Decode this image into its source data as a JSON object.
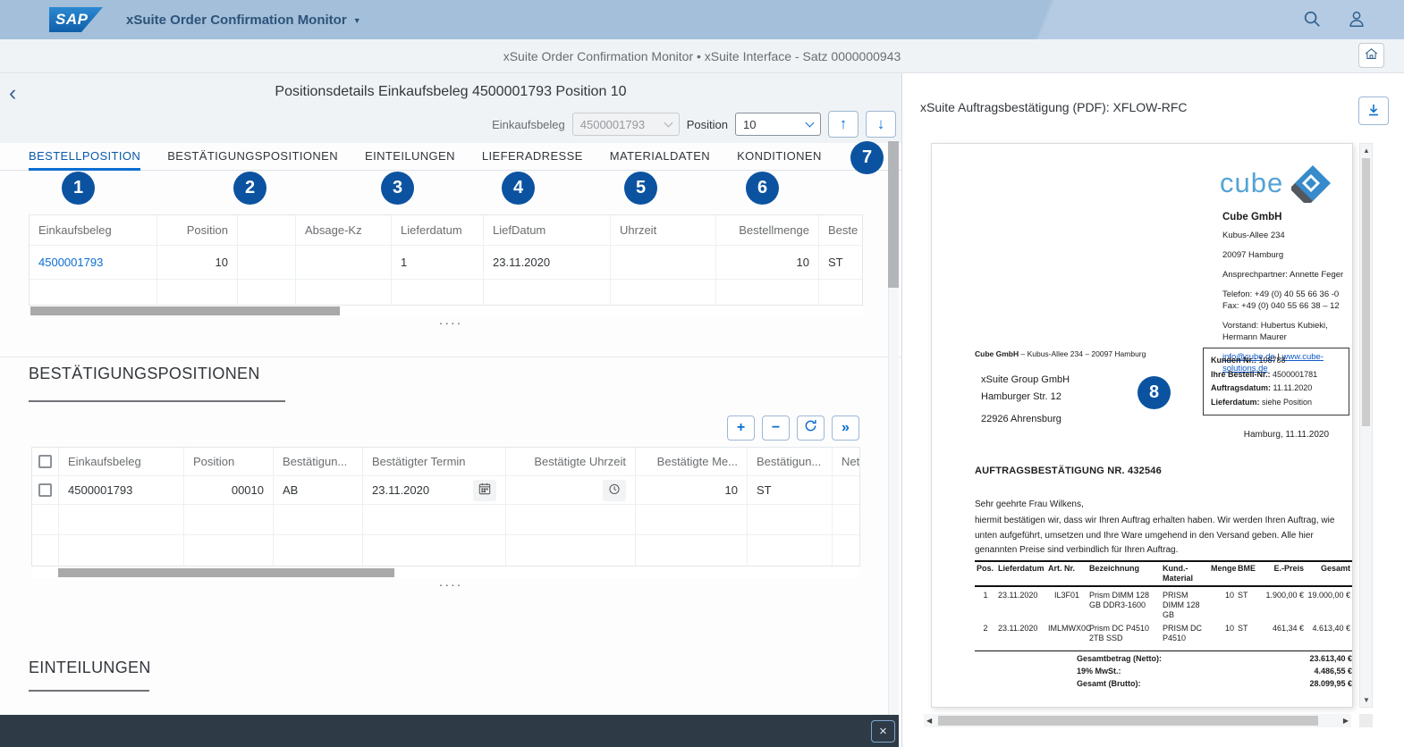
{
  "palette": {
    "accent": "#0a6ed1",
    "shell": "#a3bfda",
    "badge": "#0b53a0",
    "footer_bar": "#2e3b47",
    "link": "#0a6ed1"
  },
  "icons": {
    "back": "‹",
    "menu_caret": "▼",
    "nav_up": "↑",
    "nav_down": "↓",
    "add": "+",
    "remove": "−",
    "forward": "»",
    "close": "×",
    "scroll_up": "▲",
    "scroll_down": "▼",
    "scroll_left": "◀",
    "scroll_right": "▶"
  },
  "shell": {
    "logo_text": "SAP",
    "app_title": "xSuite Order Confirmation Monitor"
  },
  "subheader": {
    "text": "xSuite Order Confirmation Monitor • xSuite Interface - Satz 0000000943"
  },
  "detail": {
    "title": "Positionsdetails Einkaufsbeleg 4500001793 Position 10",
    "einkaufsbeleg_label": "Einkaufsbeleg",
    "einkaufsbeleg_value": "4500001793",
    "position_label": "Position",
    "position_value": "10"
  },
  "tabs": {
    "items": [
      {
        "label": "BESTELLPOSITION",
        "badge": "1"
      },
      {
        "label": "BESTÄTIGUNGSPOSITIONEN",
        "badge": "2"
      },
      {
        "label": "EINTEILUNGEN",
        "badge": "3"
      },
      {
        "label": "LIEFERADRESSE",
        "badge": "4"
      },
      {
        "label": "MATERIALDATEN",
        "badge": "5"
      },
      {
        "label": "KONDITIONEN",
        "badge": "6"
      }
    ],
    "overflow_badge": "7"
  },
  "table1": {
    "headers": [
      "Einkaufsbeleg",
      "Position",
      "",
      "Absage-Kz",
      "Lieferdatum",
      "LiefDatum",
      "Uhrzeit",
      "Bestellmenge",
      "Beste"
    ],
    "row_cells": [
      "4500001793",
      "10",
      "",
      "",
      "1",
      "23.11.2020",
      "",
      "10",
      "ST"
    ],
    "more": "····"
  },
  "section_bestaetigungen": {
    "title": "BESTÄTIGUNGSPOSITIONEN"
  },
  "table2": {
    "headers": [
      "Einkaufsbeleg",
      "Position",
      "Bestätigun...",
      "Bestätigter Termin",
      "Bestätigte Uhrzeit",
      "Bestätigte Me...",
      "Bestätigun...",
      "Nett"
    ],
    "row_cells": [
      "4500001793",
      "00010",
      "AB",
      "23.11.2020",
      "",
      "10",
      "ST",
      ""
    ],
    "more": "····"
  },
  "section_einteilungen": {
    "title": "EINTEILUNGEN"
  },
  "pdf": {
    "panel_title": "xSuite Auftragsbestätigung (PDF): XFLOW-RFC",
    "badge": "8",
    "logo_text": "cube",
    "company": {
      "name": "Cube GmbH",
      "street": "Kubus-Allee 234",
      "city": "20097 Hamburg",
      "contact": "Ansprechpartner: Annette Feger",
      "phone": "Telefon: +49 (0) 40 55 66 36 -0",
      "fax": "Fax: +49 (0) 040 55 66 38 – 12",
      "board": "Vorstand: Hubertus Kubieki, Hermann Maurer",
      "email": "info@cube.de",
      "separator": " | ",
      "website": "www.cube-solutions.de"
    },
    "sender_line": {
      "bold": "Cube GmbH",
      "rest": " – Kubus-Allee 234 – 20097 Hamburg"
    },
    "recipient": [
      "xSuite Group GmbH",
      "Hamburger Str. 12",
      "22926 Ahrensburg"
    ],
    "info_box": [
      {
        "label": "Kunden Nr.:",
        "value": "108788"
      },
      {
        "label": "Ihre Bestell-Nr.:",
        "value": "4500001781"
      },
      {
        "label": "Auftragsdatum:",
        "value": "11.11.2020"
      },
      {
        "label": "Lieferdatum:",
        "value": "siehe Position"
      }
    ],
    "dateline": "Hamburg, 11.11.2020",
    "subject": "AUFTRAGSBESTÄTIGUNG NR. 432546",
    "salutation": "Sehr geehrte Frau Wilkens,",
    "body": "hiermit bestätigen wir, dass wir Ihren Auftrag erhalten haben. Wir werden Ihren Auftrag, wie unten aufgeführt, umsetzen und Ihre Ware umgehend in den Versand geben. Alle hier genannten Preise sind verbindlich für Ihren Auftrag.",
    "items": {
      "headers": [
        "Pos.",
        "Lieferdatum",
        "Art. Nr.",
        "Bezeichnung",
        "Kund.-Material",
        "Menge",
        "BME",
        "E.-Preis",
        "Gesamt"
      ],
      "rows": [
        [
          "1",
          "23.11.2020",
          "IL3F01",
          "Prism DIMM 128 GB DDR3-1600",
          "PRISM DIMM 128 GB",
          "10",
          "ST",
          "1.900,00 €",
          "19.000,00 €"
        ],
        [
          "2",
          "23.11.2020",
          "IMLMWX0C",
          "Prism DC P4510 2TB SSD",
          "PRISM DC P4510",
          "10",
          "ST",
          "461,34 €",
          "4.613,40 €"
        ]
      ],
      "totals": [
        {
          "label": "Gesamtbetrag (Netto):",
          "value": "23.613,40 €"
        },
        {
          "label": "19% MwSt.:",
          "value": "4.486,55 €"
        },
        {
          "label": "Gesamt (Brutto):",
          "value": "28.099,95 €"
        }
      ]
    }
  }
}
